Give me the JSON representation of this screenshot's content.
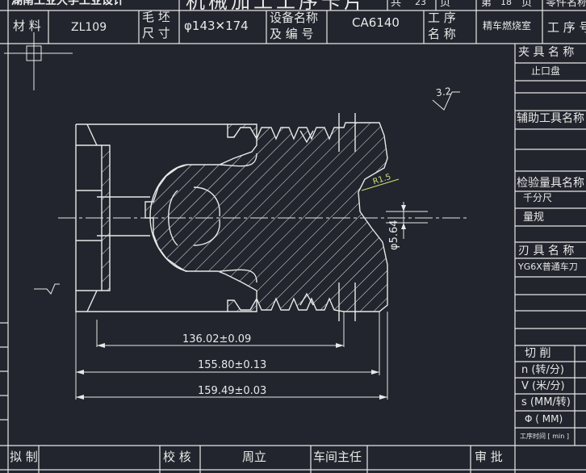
{
  "header": {
    "top_left": "湖南工业大学工业设计",
    "title": "机械加工工序卡片",
    "total_label": "共",
    "total_pages": "23",
    "total_unit": "页",
    "current_label": "第",
    "current_page": "18",
    "current_unit": "页",
    "part_name_label": "零件名称"
  },
  "info_row": {
    "material_label": "材 料",
    "material_value": "ZL109",
    "blank_label_1": "毛 坯",
    "blank_label_2": "尺 寸",
    "blank_value": "φ143✕174",
    "equip_label_1": "设备名称",
    "equip_label_2": "及 编 号",
    "equip_value": "CA6140",
    "process_label_1": "工   序",
    "process_label_2": "名   称",
    "process_value": "精车燃烧室",
    "process_no_label": "工 序 号"
  },
  "side_panel": {
    "fixture_label": "夹 具 名 称",
    "fixture_value": "止口盘",
    "aux_tool_label": "辅助工具名称",
    "gauge_label": "检验量具名称",
    "gauge_values": [
      "千分尺",
      "量规"
    ],
    "cutter_label": "刃 具 名 称",
    "cutter_value": "YG6X普通车刀",
    "cutting_label": "切    削",
    "params": [
      "n (转/分)",
      "V (米/分)",
      "s (MM/转)",
      "Φ ( MM)"
    ],
    "time_label": "工序时间 [ min ]"
  },
  "footer": {
    "drawn_label": "拟 制",
    "checked_label": "校 核",
    "checked_name": "周立",
    "workshop_label": "车间主任",
    "approve_label": "审 批"
  },
  "drawing": {
    "roughness": "3.2",
    "radius": "R1.5",
    "diameter": "φ5.64",
    "dim_1": "136.02±0.09",
    "dim_2": "155.80±0.13",
    "dim_3": "159.49±0.03"
  },
  "colors": {
    "background": "#22252d",
    "line": "#e8e8e8",
    "accent": "#cfe07a"
  }
}
